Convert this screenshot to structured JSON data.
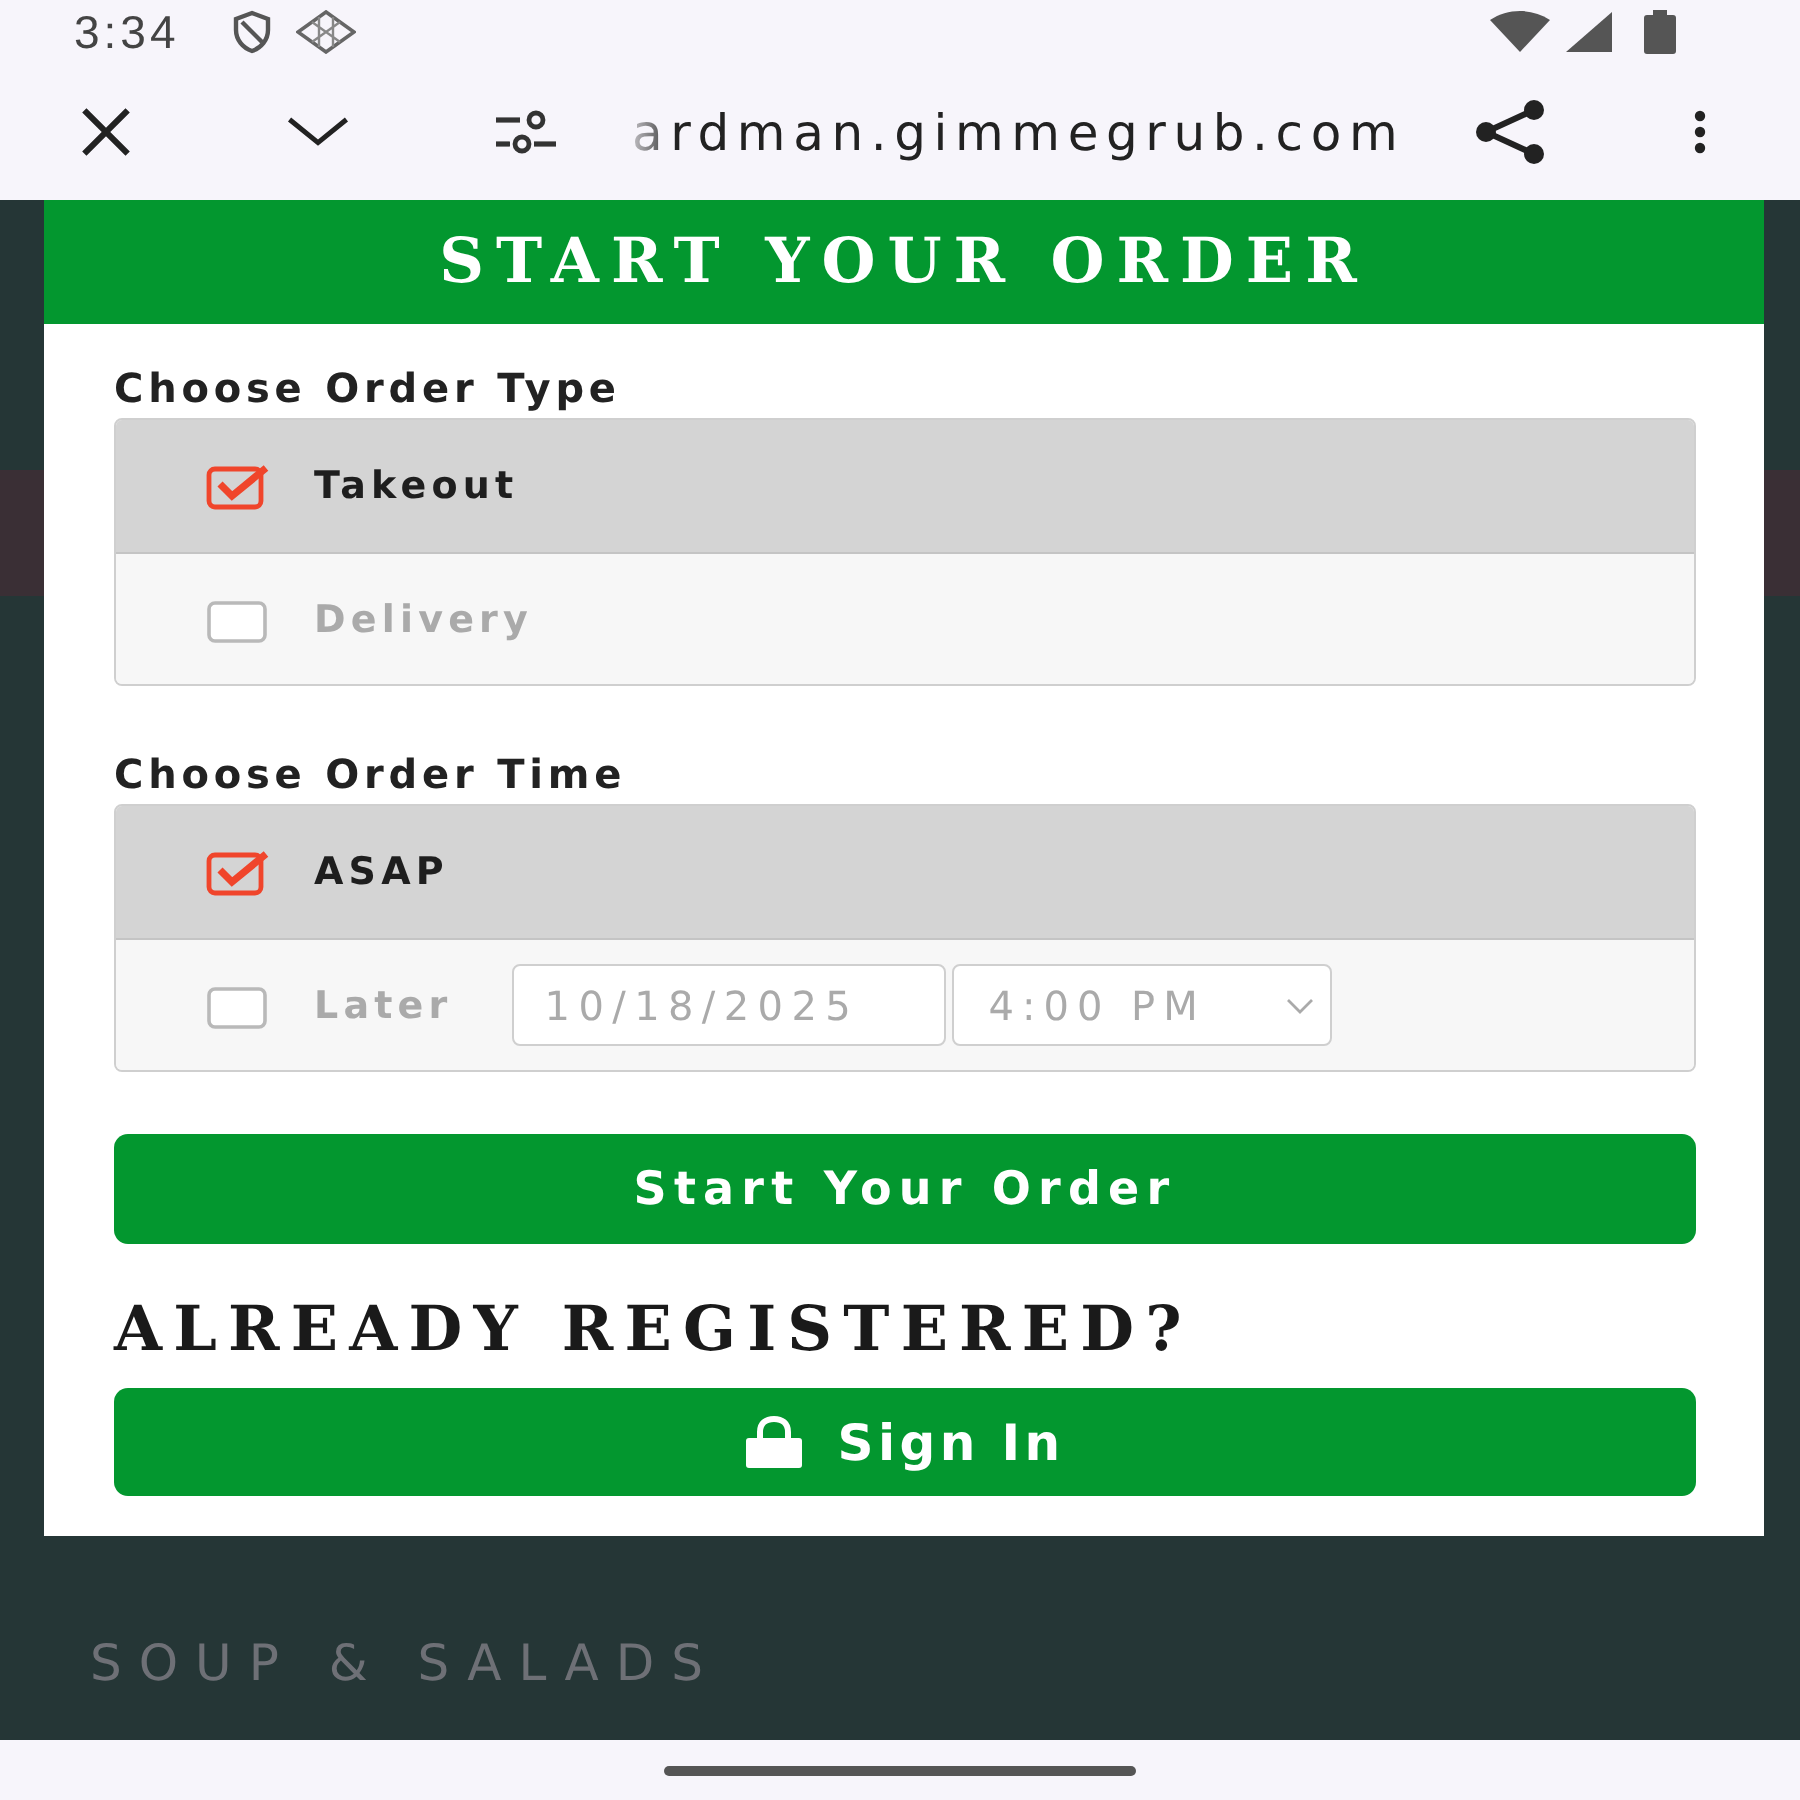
{
  "status_bar": {
    "time": "3:34"
  },
  "browser": {
    "url": "ardman.gimmegrub.com"
  },
  "modal": {
    "title": "START YOUR ORDER",
    "order_type": {
      "label": "Choose Order Type",
      "options": [
        {
          "label": "Takeout",
          "selected": true
        },
        {
          "label": "Delivery",
          "selected": false
        }
      ]
    },
    "order_time": {
      "label": "Choose Order Time",
      "options": [
        {
          "kind": "simple",
          "label": "ASAP",
          "selected": true
        },
        {
          "kind": "scheduled",
          "label": "Later",
          "selected": false,
          "date": "10/18/2025",
          "time": "4:00 PM"
        }
      ]
    },
    "submit_button": "Start Your Order",
    "register_heading": "ALREADY REGISTERED?",
    "sign_in_button": "Sign In"
  },
  "background": {
    "category": "SOUP & SALADS"
  }
}
